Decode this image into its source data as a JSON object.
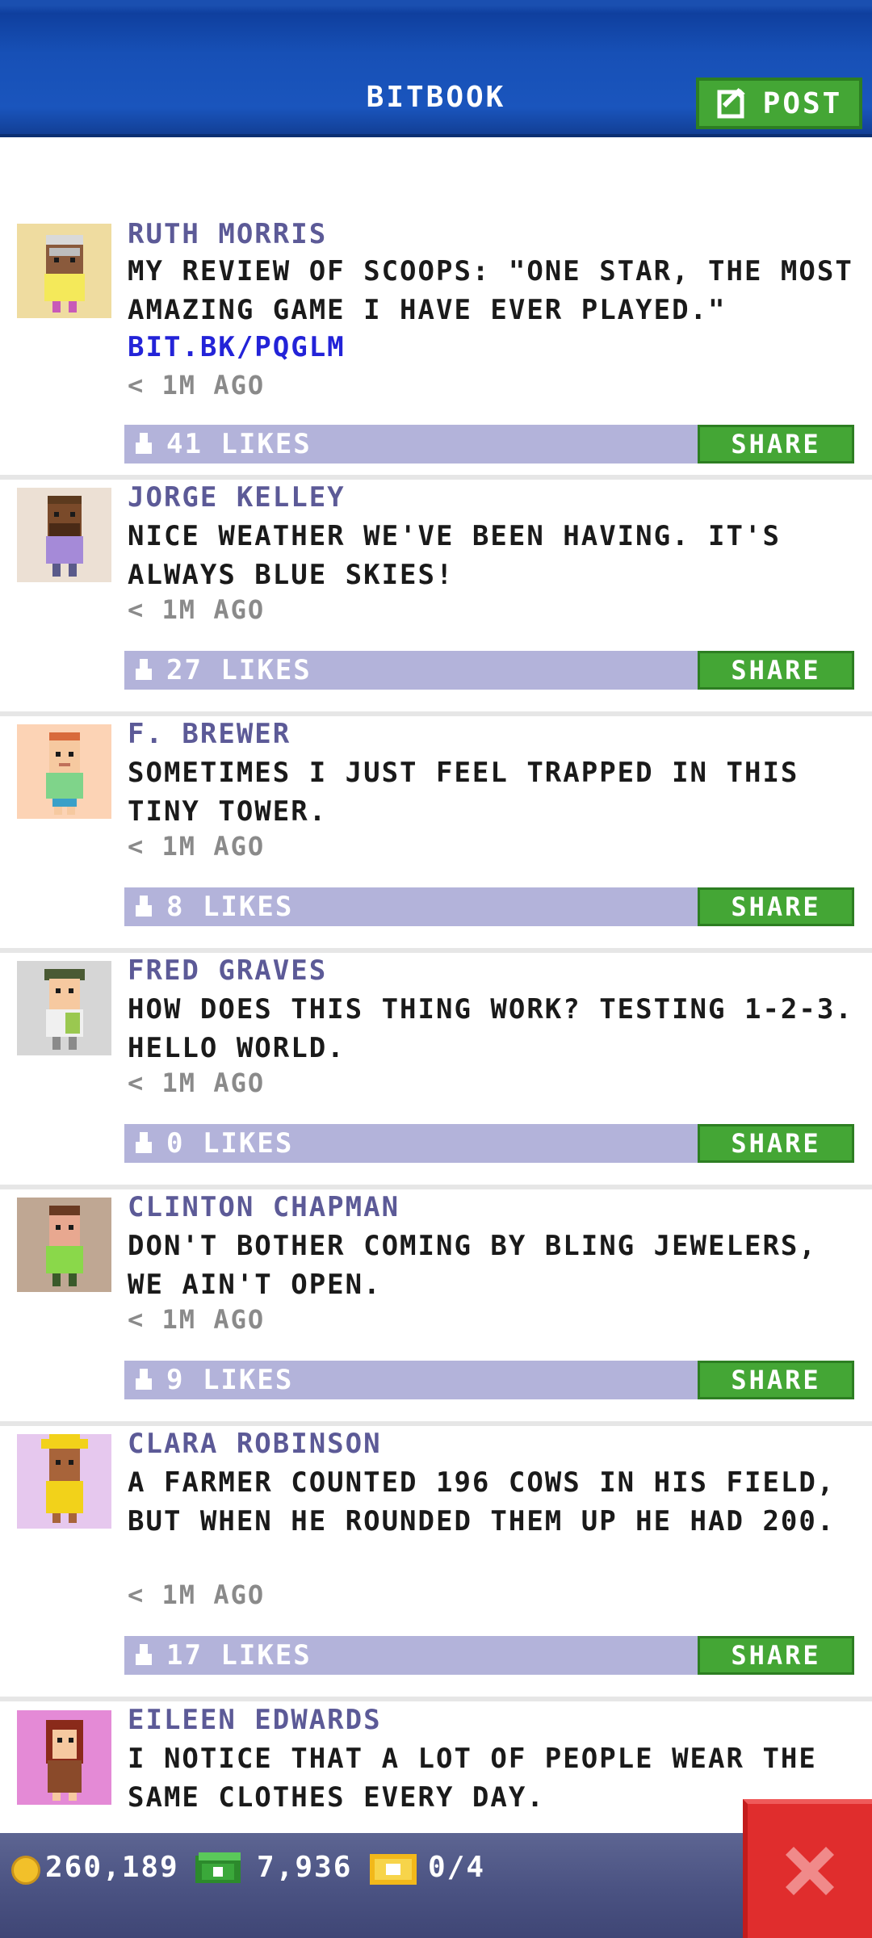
{
  "header": {
    "title": "BITBOOK",
    "post_label": "POST"
  },
  "posts": [
    {
      "author": "RUTH MORRIS",
      "message": "MY REVIEW OF SCOOPS: \"ONE STAR, THE MOST AMAZING GAME I HAVE EVER PLAYED.\"",
      "link": "BIT.BK/PQGLM",
      "time": "< 1M AGO",
      "likes": "41 LIKES",
      "share_label": "SHARE",
      "avatar_bg": "#efdca0"
    },
    {
      "author": "JORGE KELLEY",
      "message": "NICE WEATHER WE'VE BEEN HAVING. IT'S ALWAYS BLUE SKIES!",
      "time": "< 1M AGO",
      "likes": "27 LIKES",
      "share_label": "SHARE",
      "avatar_bg": "#ece0d4"
    },
    {
      "author": "F. BREWER",
      "message": "SOMETIMES I JUST FEEL TRAPPED IN THIS TINY TOWER.",
      "time": "< 1M AGO",
      "likes": "8 LIKES",
      "share_label": "SHARE",
      "avatar_bg": "#fcd3b5"
    },
    {
      "author": "FRED GRAVES",
      "message": "HOW DOES THIS THING WORK? TESTING 1-2-3. HELLO WORLD.",
      "time": "< 1M AGO",
      "likes": "0 LIKES",
      "share_label": "SHARE",
      "avatar_bg": "#d6d6d6"
    },
    {
      "author": "CLINTON CHAPMAN",
      "message": "DON'T BOTHER COMING BY BLING JEWELERS, WE AIN'T OPEN.",
      "time": "< 1M AGO",
      "likes": "9 LIKES",
      "share_label": "SHARE",
      "avatar_bg": "#bfa793"
    },
    {
      "author": "CLARA ROBINSON",
      "message": "A FARMER COUNTED 196 COWS IN HIS FIELD, BUT WHEN HE ROUNDED THEM UP HE HAD 200.",
      "time": "< 1M AGO",
      "likes": "17 LIKES",
      "share_label": "SHARE",
      "avatar_bg": "#e6c8ee"
    },
    {
      "author": "EILEEN EDWARDS",
      "message": "I NOTICE THAT A LOT OF PEOPLE WEAR THE SAME CLOTHES EVERY DAY.",
      "avatar_bg": "#e48ad6"
    }
  ],
  "bottom_bar": {
    "coins": "260,189",
    "bux": "7,936",
    "tickets": "0/4"
  },
  "colors": {
    "header_blue": "#1a55bd",
    "author_purple": "#5c5a97",
    "link_blue": "#2323d8",
    "likes_bar": "#b3b3da",
    "share_green": "#44a635",
    "close_red": "#e02d2d"
  }
}
